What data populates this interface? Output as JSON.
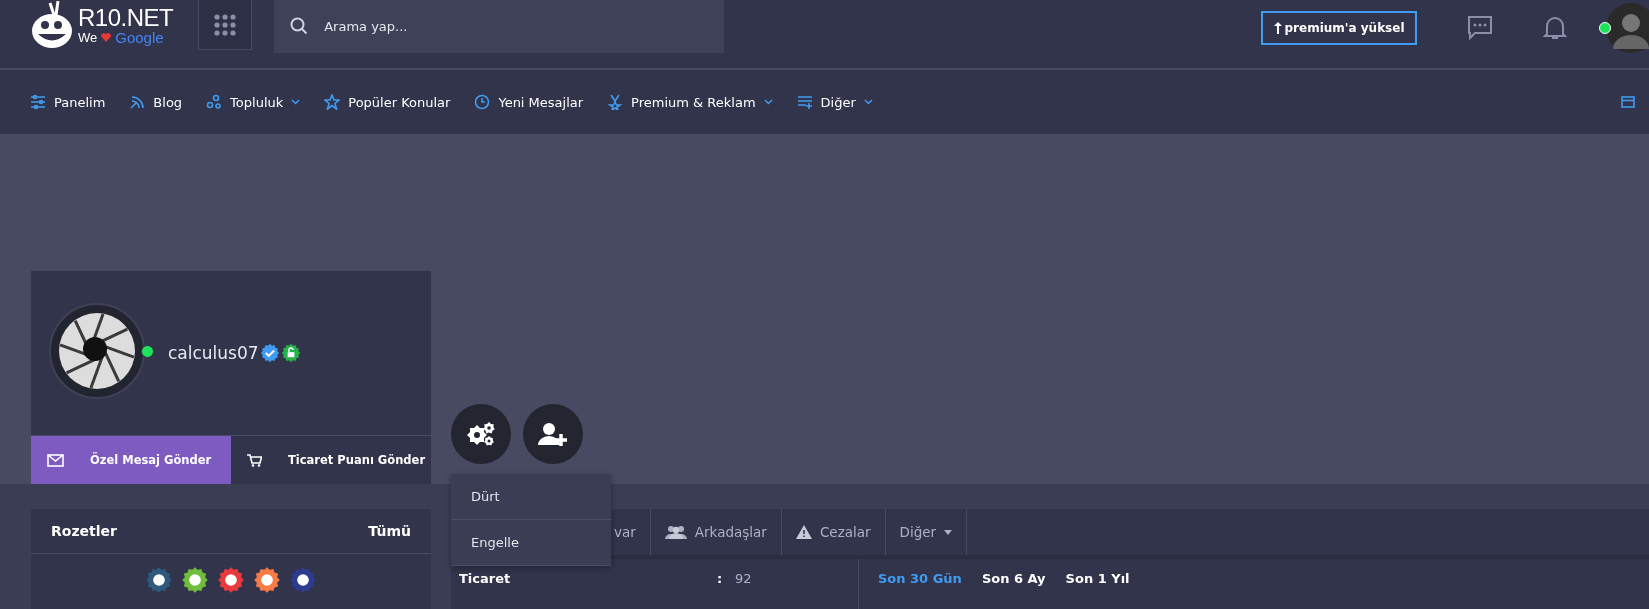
{
  "header": {
    "logo": {
      "name": "R10.NET",
      "tagline_start": "We",
      "tagline_brand": "Google"
    },
    "search": {
      "placeholder": "Arama yap..."
    },
    "premium_button": "premium'a yüksel",
    "user_online": true
  },
  "nav": [
    {
      "label": "Panelim",
      "dropdown": false
    },
    {
      "label": "Blog",
      "dropdown": false
    },
    {
      "label": "Topluluk",
      "dropdown": true
    },
    {
      "label": "Popüler Konular",
      "dropdown": false
    },
    {
      "label": "Yeni Mesajlar",
      "dropdown": false
    },
    {
      "label": "Premium & Reklam",
      "dropdown": true
    },
    {
      "label": "Diğer",
      "dropdown": true
    }
  ],
  "profile": {
    "username": "calculus07",
    "online": true,
    "verified": true,
    "actions": [
      {
        "label": "Özel Mesaj Gönder",
        "selected": true
      },
      {
        "label": "Ticaret Puanı Gönder",
        "selected": false
      }
    ]
  },
  "menu": [
    "Dürt",
    "Engelle"
  ],
  "badges_panel": {
    "title": "Rozetler",
    "link": "Tümü",
    "badges": [
      {
        "color": "#2f5a7e"
      },
      {
        "color": "#6fbd3a"
      },
      {
        "color": "#e8393d"
      },
      {
        "color": "#f57c45"
      },
      {
        "color": "#2f3b8f"
      }
    ]
  },
  "tabs": [
    {
      "label": "var"
    },
    {
      "label": "Arkadaşlar"
    },
    {
      "label": "Cezalar"
    },
    {
      "label": "Diğer"
    }
  ],
  "stats": [
    {
      "label": "Ticaret",
      "separator": ":",
      "value": "92"
    }
  ],
  "periods": [
    {
      "label": "Son 30 Gün",
      "selected": true
    },
    {
      "label": "Son 6 Ay",
      "selected": false
    },
    {
      "label": "Son 1 Yıl",
      "selected": false
    }
  ]
}
